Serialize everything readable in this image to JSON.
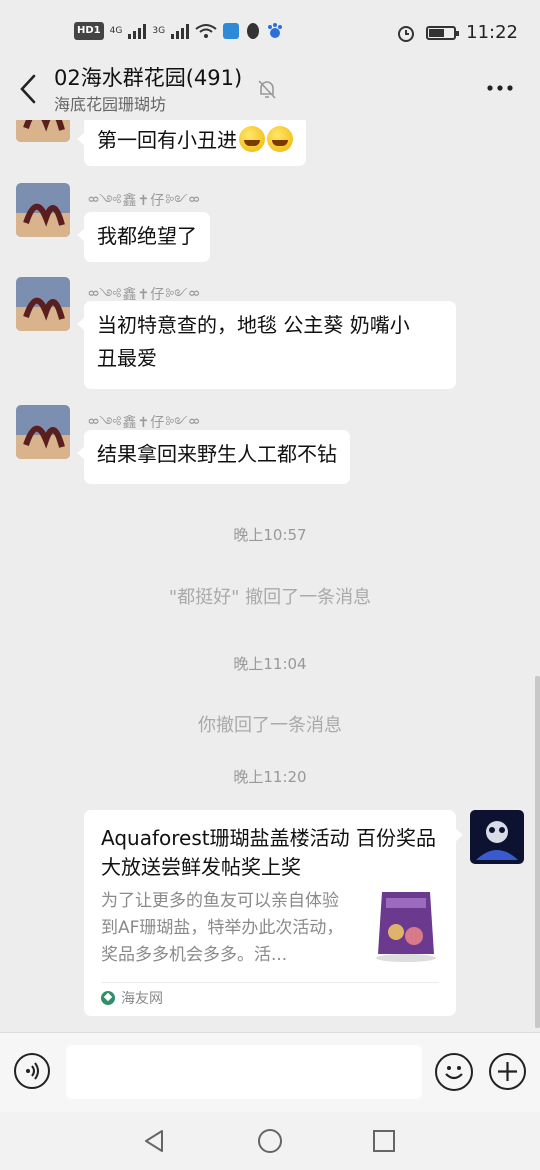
{
  "status_bar": {
    "chip": "HD",
    "chip_sub": "1",
    "signal1": "4G",
    "signal2": "3G",
    "time": "11:22",
    "battery_level": 0.6
  },
  "header": {
    "title": "02海水群花园(491)",
    "subtitle": "海底花园珊瑚坊"
  },
  "messages": [
    {
      "text": "第一回有小丑进"
    },
    {
      "nick": "ᢁ༺鑫✝仔༻ᢁ",
      "text": "我都绝望了"
    },
    {
      "nick": "ᢁ༺鑫✝仔༻ᢁ",
      "text_line1": "当初特意查的，地毯 公主葵 奶嘴小",
      "text_line2": "丑最爱"
    },
    {
      "nick": "ᢁ༺鑫✝仔༻ᢁ",
      "text": "结果拿回来野生人工都不钻"
    }
  ],
  "system": [
    {
      "text": "晚上10:57"
    },
    {
      "text": "\"都挺好\" 撤回了一条消息"
    },
    {
      "text": "晚上11:04"
    },
    {
      "text": "你撤回了一条消息"
    },
    {
      "text": "晚上11:20"
    }
  ],
  "link_card": {
    "title": "Aquaforest珊瑚盐盖楼活动 百份奖品大放送尝鲜发帖奖上奖",
    "description": "为了让更多的鱼友可以亲自体验到AF珊瑚盐，特举办此次活动，奖品多多机会多多。活...",
    "source": "海友网"
  },
  "input": {
    "placeholder": ""
  },
  "colors": {
    "background": "#ededed",
    "bubble": "#ffffff",
    "system_text": "#999999"
  },
  "icons": [
    "back-arrow-icon",
    "mute-bell-icon",
    "more-icon",
    "voice-icon",
    "emoji-icon",
    "plus-icon",
    "nav-back-icon",
    "nav-home-icon",
    "nav-recent-icon"
  ]
}
